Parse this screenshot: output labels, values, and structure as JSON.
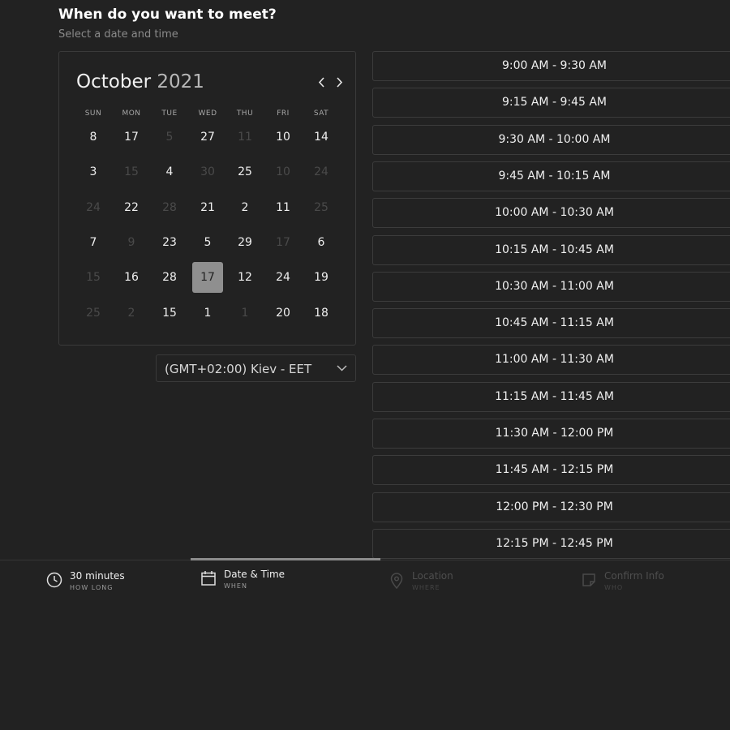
{
  "header": {
    "title": "When do you want to meet?",
    "subtitle": "Select a date and time"
  },
  "calendar": {
    "month": "October",
    "year": "2021",
    "weekdays": [
      "SUN",
      "MON",
      "TUE",
      "WED",
      "THU",
      "FRI",
      "SAT"
    ],
    "weeks": [
      [
        {
          "d": "8"
        },
        {
          "d": "17"
        },
        {
          "d": "5",
          "muted": true
        },
        {
          "d": "27"
        },
        {
          "d": "11",
          "muted": true
        },
        {
          "d": "10"
        },
        {
          "d": "14"
        }
      ],
      [
        {
          "d": "3"
        },
        {
          "d": "15",
          "muted": true
        },
        {
          "d": "4"
        },
        {
          "d": "30",
          "muted": true
        },
        {
          "d": "25"
        },
        {
          "d": "10",
          "muted": true
        },
        {
          "d": "24",
          "muted": true
        }
      ],
      [
        {
          "d": "24",
          "muted": true
        },
        {
          "d": "22"
        },
        {
          "d": "28",
          "muted": true
        },
        {
          "d": "21"
        },
        {
          "d": "2"
        },
        {
          "d": "11"
        },
        {
          "d": "25",
          "muted": true
        }
      ],
      [
        {
          "d": "7"
        },
        {
          "d": "9",
          "muted": true
        },
        {
          "d": "23"
        },
        {
          "d": "5"
        },
        {
          "d": "29"
        },
        {
          "d": "17",
          "muted": true
        },
        {
          "d": "6"
        }
      ],
      [
        {
          "d": "15",
          "muted": true
        },
        {
          "d": "16"
        },
        {
          "d": "28"
        },
        {
          "d": "17",
          "selected": true
        },
        {
          "d": "12"
        },
        {
          "d": "24"
        },
        {
          "d": "19"
        }
      ],
      [
        {
          "d": "25",
          "muted": true
        },
        {
          "d": "2",
          "muted": true
        },
        {
          "d": "15"
        },
        {
          "d": "1"
        },
        {
          "d": "1",
          "muted": true
        },
        {
          "d": "20"
        },
        {
          "d": "18"
        }
      ]
    ],
    "prev_icon": "chevron-left-icon",
    "next_icon": "chevron-right-icon"
  },
  "timezone": {
    "value": "(GMT+02:00) Kiev - EET",
    "icon": "chevron-down-icon"
  },
  "time_slots": [
    "9:00 AM - 9:30 AM",
    "9:15 AM - 9:45 AM",
    "9:30 AM - 10:00 AM",
    "9:45 AM - 10:15 AM",
    "10:00 AM - 10:30 AM",
    "10:15 AM - 10:45 AM",
    "10:30 AM - 11:00 AM",
    "10:45 AM - 11:15 AM",
    "11:00 AM - 11:30 AM",
    "11:15 AM - 11:45 AM",
    "11:30 AM - 12:00 PM",
    "11:45 AM - 12:15 PM",
    "12:00 PM - 12:30 PM",
    "12:15 PM - 12:45 PM"
  ],
  "steps": [
    {
      "label": "30 minutes",
      "sub": "HOW LONG",
      "icon": "clock-icon",
      "active": true
    },
    {
      "label": "Date & Time",
      "sub": "WHEN",
      "icon": "calendar-icon",
      "active": true,
      "current": true
    },
    {
      "label": "Location",
      "sub": "WHERE",
      "icon": "map-pin-icon",
      "active": false
    },
    {
      "label": "Confirm Info",
      "sub": "WHO",
      "icon": "note-icon",
      "active": false
    }
  ],
  "colors": {
    "background": "#222222",
    "border": "#3a3a3a",
    "selected_day": "#8f8f8f",
    "muted_text": "#4a4a4a",
    "progress_bar": "#8c8c8c"
  }
}
